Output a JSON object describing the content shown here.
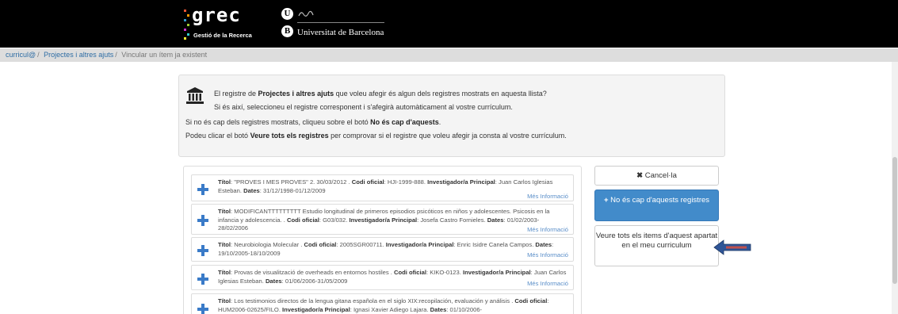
{
  "header": {
    "logo_text": "grec",
    "logo_subtitle": "Gestió de la Recerca",
    "university_name": "Universitat de Barcelona",
    "university_marks": [
      "U",
      "B"
    ],
    "background": "#000000"
  },
  "breadcrumb": {
    "items": [
      "curricul@",
      "Projectes i altres ajuts",
      "Vincular un ítem ja existent"
    ],
    "separator": "/"
  },
  "info": {
    "icon": "bank-icon",
    "line1_pre": "El registre de ",
    "line1_bold": "Projectes i altres ajuts",
    "line1_post": " que voleu afegir és algun dels registres mostrats en aquesta llista?",
    "line2": "Si és així, seleccioneu el registre corresponent i s'afegirà automàticament al vostre currículum.",
    "line3_pre": "Si no és cap dels registres mostrats, cliqueu sobre el botó ",
    "line3_bold": "No és cap d'aquests",
    "line3_post": ".",
    "line4_pre": "Podeu clicar el botó ",
    "line4_bold": "Veure tots els registres",
    "line4_post": " per comprovar si el registre que voleu afegir ja consta al vostre currículum."
  },
  "labels": {
    "title": "Títol",
    "code": "Codi oficial",
    "investigator": "Investigador/a Principal",
    "dates": "Dates"
  },
  "items": [
    {
      "title": ": \"PROVES I MES PROVES\" 2. 30/03/2012 . ",
      "code": ": HJI-1999-888. ",
      "investigator": ": Juan Carlos Iglesias Esteban. ",
      "dates": ": 31/12/1998-01/12/2009",
      "more": "Més Informació"
    },
    {
      "title": ": MODIFICANTTTTTTTTT Estudio longitudinal de primeros episodios psicóticos en niños y adolescentes. Psicosis en la infancia y adolescencia. . ",
      "code": ": G03/032. ",
      "investigator": ": Josefa Castro Fornieles. ",
      "dates": ": 01/02/2003-28/02/2006",
      "more": "Més Informació"
    },
    {
      "title": ": Neurobiologia Molecular . ",
      "code": ": 2005SGR00711. ",
      "investigator": ": Enric Isidre Canela Campos. ",
      "dates": ": 19/10/2005-18/10/2009",
      "more": "Més Informació"
    },
    {
      "title": ": Provas de visualització de overheads en entornos hostiles . ",
      "code": ": KIKO-0123. ",
      "investigator": ": Juan Carlos Iglesias Esteban. ",
      "dates": ": 01/06/2006-31/05/2009",
      "more": "Més Informació"
    },
    {
      "title": ": Los testimonios directos de la lengua gitana española en el siglo XIX:recopilación, evaluación y análisis . ",
      "code": ": HUM2006-02625/FILO. ",
      "investigator": ": Ignasi Xavier Adiego Lajara. ",
      "dates": ": 01/10/2006-",
      "more": ""
    }
  ],
  "buttons": {
    "cancel": "Cancel·la",
    "cancel_icon": "close-icon",
    "none": "No és cap d'aquests registres",
    "none_icon": "plus-icon",
    "view_all": "Veure tots els items d'aquest apartat en el meu curriculum"
  },
  "colors": {
    "primary": "#428bca",
    "link": "#2e6da4",
    "arrow": "#2f5597",
    "arrow_accent": "#c0504d"
  }
}
